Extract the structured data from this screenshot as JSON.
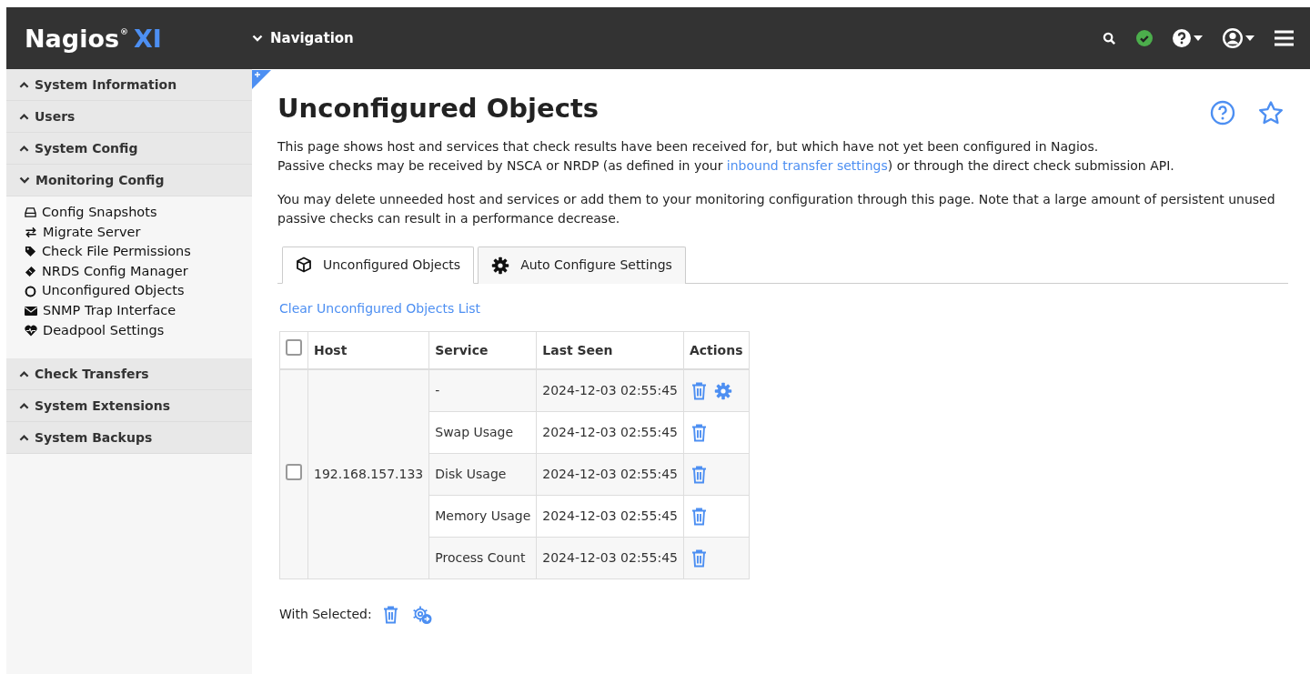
{
  "header": {
    "logo": {
      "name": "Nagios",
      "mark": "®",
      "suffix": "XI"
    },
    "nav_toggle": "Navigation",
    "status_ok": true
  },
  "sidebar": {
    "sections": [
      {
        "label": "System Information",
        "expanded": false
      },
      {
        "label": "Users",
        "expanded": false
      },
      {
        "label": "System Config",
        "expanded": false
      },
      {
        "label": "Monitoring Config",
        "expanded": true,
        "items": [
          {
            "label": "Config Snapshots",
            "kind": "drive"
          },
          {
            "label": "Migrate Server",
            "kind": "arrows"
          },
          {
            "label": "Check File Permissions",
            "kind": "tag"
          },
          {
            "label": "NRDS Config Manager",
            "kind": "ticket"
          },
          {
            "label": "Unconfigured Objects",
            "kind": "circle"
          },
          {
            "label": "SNMP Trap Interface",
            "kind": "envelope"
          },
          {
            "label": "Deadpool Settings",
            "kind": "heartbeat"
          }
        ]
      },
      {
        "label": "Check Transfers",
        "expanded": false
      },
      {
        "label": "System Extensions",
        "expanded": false
      },
      {
        "label": "System Backups",
        "expanded": false
      }
    ]
  },
  "page": {
    "title": "Unconfigured Objects",
    "intro": [
      {
        "text": "This page shows host and services that check results have been received for, but which have not yet been configured in Nagios."
      },
      {
        "text": "Passive checks may be received by NSCA or NRDP (as defined in your ",
        "link": "inbound transfer settings",
        "after": ") or through the direct check submission API."
      }
    ],
    "note": "You may delete unneeded host and services or add them to your monitoring configuration through this page. Note that a large amount of persistent unused passive checks can result in a performance decrease.",
    "tabs": [
      {
        "label": "Unconfigured Objects",
        "kind": "cube",
        "selected": true
      },
      {
        "label": "Auto Configure Settings",
        "kind": "gear",
        "selected": false
      }
    ],
    "clear_link": "Clear Unconfigured Objects List",
    "table": {
      "columns": [
        "Host",
        "Service",
        "Last Seen",
        "Actions"
      ],
      "all_checked": false,
      "hosts": [
        {
          "host": "192.168.157.133",
          "checked": false,
          "rows": [
            {
              "service": "-",
              "last_seen": "2024-12-03 02:55:45",
              "actions": [
                {
                  "kind": "trash"
                },
                {
                  "kind": "gear"
                }
              ]
            },
            {
              "service": "Swap Usage",
              "last_seen": "2024-12-03 02:55:45",
              "actions": [
                {
                  "kind": "trash"
                }
              ]
            },
            {
              "service": "Disk Usage",
              "last_seen": "2024-12-03 02:55:45",
              "actions": [
                {
                  "kind": "trash"
                }
              ]
            },
            {
              "service": "Memory Usage",
              "last_seen": "2024-12-03 02:55:45",
              "actions": [
                {
                  "kind": "trash"
                }
              ]
            },
            {
              "service": "Process Count",
              "last_seen": "2024-12-03 02:55:45",
              "actions": [
                {
                  "kind": "trash"
                }
              ]
            }
          ]
        }
      ]
    },
    "with_selected": {
      "label": "With Selected:",
      "actions": [
        {
          "kind": "trash"
        },
        {
          "kind": "gear-arrow"
        }
      ]
    }
  }
}
